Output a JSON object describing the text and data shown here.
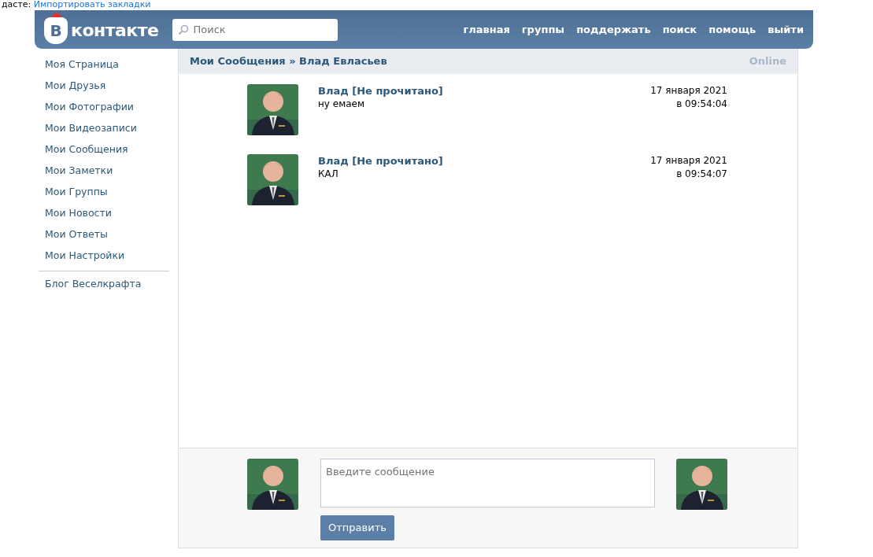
{
  "browser_bar": {
    "text": "дасте:",
    "link": "Импортировать закладки"
  },
  "header": {
    "logo_letter": "В",
    "logo_text": "контакте",
    "search": {
      "placeholder": "Поиск"
    },
    "nav": [
      "главная",
      "группы",
      "поддержать",
      "поиск",
      "помощь",
      "выйти"
    ]
  },
  "sidebar": {
    "items": [
      {
        "label": "Моя Страница"
      },
      {
        "label": "Мои Друзья"
      },
      {
        "label": "Мои Фотографии"
      },
      {
        "label": "Мои Видеозаписи"
      },
      {
        "label": "Мои Сообщения"
      },
      {
        "label": "Мои Заметки"
      },
      {
        "label": "Мои Группы"
      },
      {
        "label": "Мои Новости"
      },
      {
        "label": "Мои Ответы"
      },
      {
        "label": "Мои Настройки"
      }
    ],
    "extra": [
      {
        "label": "Блог Веселкрафта"
      }
    ]
  },
  "conversation": {
    "title": "Мои Сообщения » Влад Евласьев",
    "status": "Online",
    "messages": [
      {
        "author": "Влад [Не прочитано]",
        "text": "ну емаем",
        "date": "17 января 2021",
        "time": "в 09:54:04"
      },
      {
        "author": "Влад [Не прочитано]",
        "text": "КАЛ",
        "date": "17 января 2021",
        "time": "в 09:54:07"
      }
    ],
    "composer": {
      "placeholder": "Введите сообщение",
      "button": "Отправить"
    }
  }
}
